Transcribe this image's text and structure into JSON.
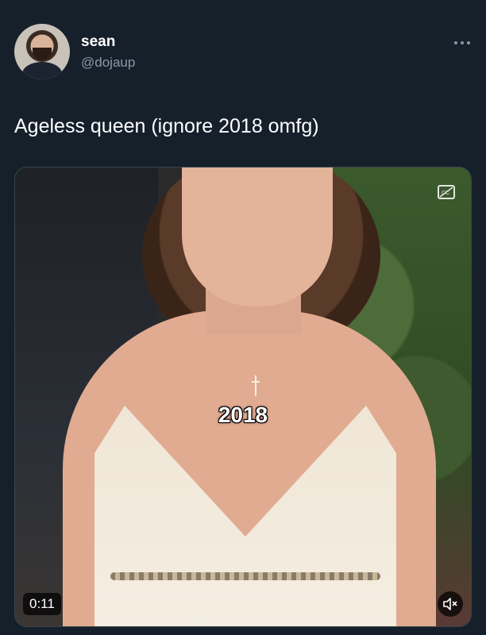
{
  "tweet": {
    "author": {
      "display_name": "sean",
      "handle": "@dojaup"
    },
    "text": "Ageless queen (ignore 2018 omfg)"
  },
  "media": {
    "overlay_text": "2018",
    "duration": "0:11",
    "caption_icon": "closed-captions-off-icon",
    "mute_icon": "volume-muted-icon"
  },
  "icons": {
    "more": "more-horizontal-icon"
  },
  "colors": {
    "background": "#15202b",
    "secondary_text": "#8899a6"
  }
}
